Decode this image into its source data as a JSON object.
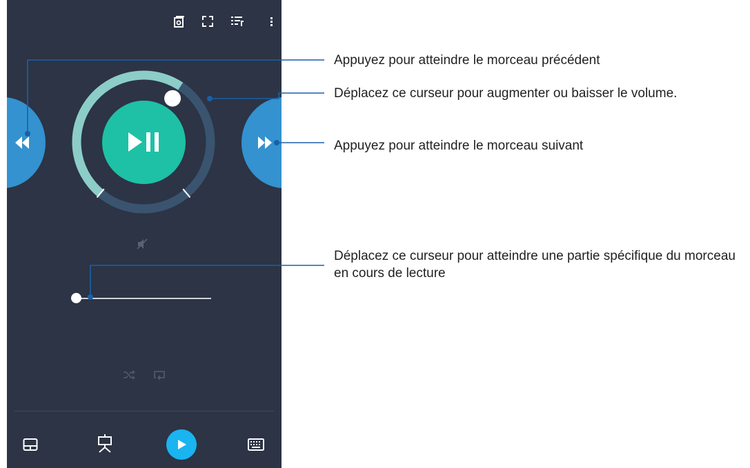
{
  "top_bar": {
    "icons": [
      "media-source-icon",
      "fullscreen-icon",
      "playlist-icon",
      "more-vert-icon"
    ]
  },
  "player": {
    "prev_icon": "rewind-icon",
    "next_icon": "fast-forward-icon",
    "center_icon": "play-pause-icon",
    "volume_level": 0.62,
    "seek_position": 0.0,
    "mute_icon": "volume-mute-icon",
    "shuffle_icon": "shuffle-icon",
    "repeat_icon": "repeat-icon"
  },
  "bottom_bar": {
    "icons": [
      "touchpad-icon",
      "presentation-icon",
      "play-icon",
      "keyboard-icon"
    ]
  },
  "callouts": {
    "prev_label": "Appuyez pour atteindre le morceau précédent",
    "volume_label": "Déplacez ce curseur pour augmenter ou baisser le volume.",
    "next_label": "Appuyez pour atteindre le morceau suivant",
    "seek_label": "Déplacez ce curseur pour atteindre une partie spécifique du morceau en cours de lecture"
  },
  "colors": {
    "background": "#2c3445",
    "side_buttons": "#3392cf",
    "play_button": "#1ec1a6",
    "volume_arc": "#8ccdc8",
    "dial_track": "#3a5470",
    "bottom_play": "#1ab4f0",
    "callout_line": "#1b5fa8"
  }
}
